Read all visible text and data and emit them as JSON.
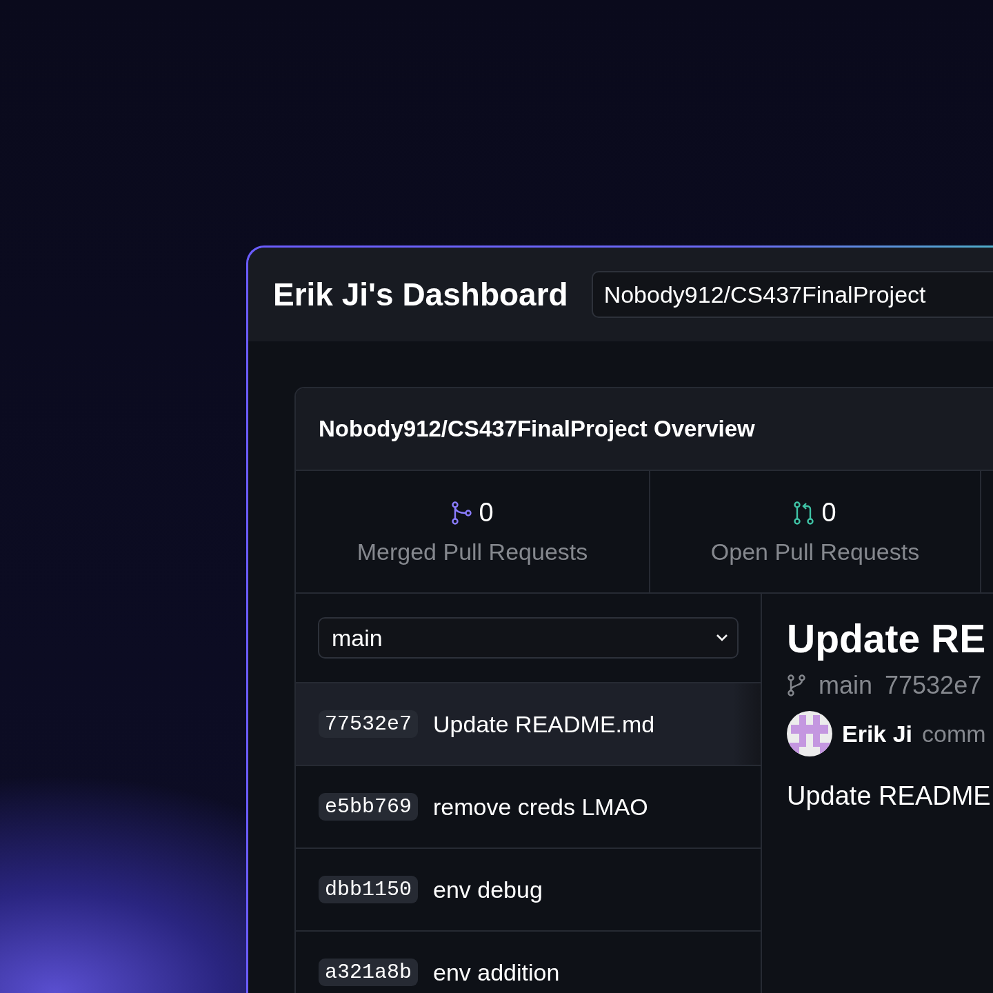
{
  "header": {
    "title": "Erik Ji's Dashboard",
    "repo_select": "Nobody912/CS437FinalProject"
  },
  "overview": {
    "title": "Nobody912/CS437FinalProject Overview",
    "stats": [
      {
        "kind": "merged",
        "count": "0",
        "label": "Merged Pull Requests"
      },
      {
        "kind": "open",
        "count": "0",
        "label": "Open Pull Requests"
      }
    ]
  },
  "branch_select": "main",
  "commits": [
    {
      "hash": "77532e7",
      "message": "Update README.md",
      "selected": true
    },
    {
      "hash": "e5bb769",
      "message": "remove creds LMAO",
      "selected": false
    },
    {
      "hash": "dbb1150",
      "message": "env debug",
      "selected": false
    },
    {
      "hash": "a321a8b",
      "message": "env addition",
      "selected": false
    }
  ],
  "detail": {
    "title": "Update RE",
    "branch": "main",
    "hash": "77532e7",
    "author": "Erik Ji",
    "action": "comm",
    "message": "Update README"
  }
}
